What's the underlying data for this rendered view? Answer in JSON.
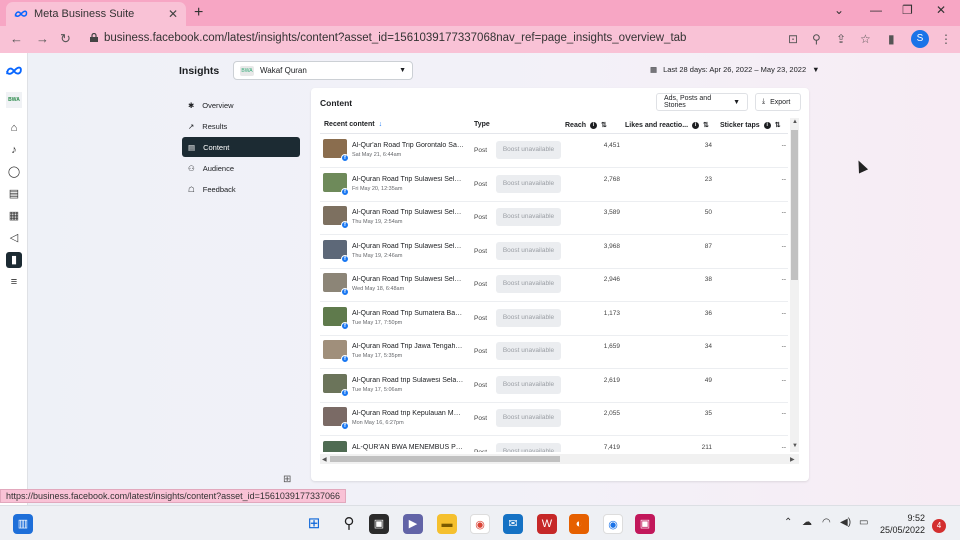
{
  "browser": {
    "tab_title": "Meta Business Suite",
    "tab_close": "✕",
    "new_tab": "+",
    "url": "business.facebook.com/latest/insights/content?asset_id=1561039177337068nav_ref=page_insights_overview_tab",
    "profile_initial": "S",
    "status_url": "https://business.facebook.com/latest/insights/content?asset_id=1561039177337066"
  },
  "rail": {
    "brand_label": "BWA"
  },
  "header": {
    "title": "Insights",
    "page_name": "Wakaf Quran",
    "page_avatar": "BWA",
    "date_range": "Last 28 days: Apr 26, 2022 – May 23, 2022"
  },
  "subnav": [
    {
      "label": "Overview",
      "icon": "sparkle-icon"
    },
    {
      "label": "Results",
      "icon": "chart-line-icon"
    },
    {
      "label": "Content",
      "icon": "content-icon"
    },
    {
      "label": "Audience",
      "icon": "people-icon"
    },
    {
      "label": "Feedback",
      "icon": "comment-icon"
    }
  ],
  "content": {
    "title": "Content",
    "filter_label": "Ads, Posts and Stories",
    "export_label": "Export",
    "columns": {
      "recent": "Recent content",
      "type": "Type",
      "reach": "Reach",
      "likes": "Likes and reactio...",
      "sticker": "Sticker taps"
    },
    "rows": [
      {
        "title": "Al-Qur'an Road Trip Gorontalo Sab...",
        "date": "Sat May 21, 6:44am",
        "type": "Post",
        "boost": "Boost unavailable",
        "reach": "4,451",
        "likes": "34",
        "sticker": "--",
        "thumb": "#8a6d4e"
      },
      {
        "title": "Al-Quran Road Trip Sulawesi Selata...",
        "date": "Fri May 20, 12:35am",
        "type": "Post",
        "boost": "Boost unavailable",
        "reach": "2,768",
        "likes": "23",
        "sticker": "--",
        "thumb": "#6e8a5a"
      },
      {
        "title": "Al-Quran Road Trip Sulawesi Selata...",
        "date": "Thu May 19, 2:54am",
        "type": "Post",
        "boost": "Boost unavailable",
        "reach": "3,589",
        "likes": "50",
        "sticker": "--",
        "thumb": "#7d7060"
      },
      {
        "title": "Al-Quran Road Trip Sulawesi Selata...",
        "date": "Thu May 19, 2:46am",
        "type": "Post",
        "boost": "Boost unavailable",
        "reach": "3,968",
        "likes": "87",
        "sticker": "--",
        "thumb": "#5d6878"
      },
      {
        "title": "Al-Quran Road Trip Sulawesi Selata...",
        "date": "Wed May 18, 6:48am",
        "type": "Post",
        "boost": "Boost unavailable",
        "reach": "2,946",
        "likes": "38",
        "sticker": "--",
        "thumb": "#8c8577"
      },
      {
        "title": "Al-Quran Road Trip Sumatera Barat...",
        "date": "Tue May 17, 7:50pm",
        "type": "Post",
        "boost": "Boost unavailable",
        "reach": "1,173",
        "likes": "36",
        "sticker": "--",
        "thumb": "#5f7a4c"
      },
      {
        "title": "Al-Quran Road Trip Jawa Tengah Di...",
        "date": "Tue May 17, 5:35pm",
        "type": "Post",
        "boost": "Boost unavailable",
        "reach": "1,659",
        "likes": "34",
        "sticker": "--",
        "thumb": "#a08f7b"
      },
      {
        "title": "Al-Quran Road trip Sulawesi Selata...",
        "date": "Tue May 17, 5:06am",
        "type": "Post",
        "boost": "Boost unavailable",
        "reach": "2,619",
        "likes": "49",
        "sticker": "--",
        "thumb": "#6b745a"
      },
      {
        "title": "Al-Quran Road trip Kepulauan Mal...",
        "date": "Mon May 16, 6:27pm",
        "type": "Post",
        "boost": "Boost unavailable",
        "reach": "2,055",
        "likes": "35",
        "sticker": "--",
        "thumb": "#7a6a65"
      },
      {
        "title": "AL-QUR'AN BWA MENEMBUS PED...",
        "date": "",
        "type": "Post",
        "boost": "Boost unavailable",
        "reach": "7,419",
        "likes": "211",
        "sticker": "--",
        "thumb": "#4f6b52"
      }
    ]
  },
  "taskbar": {
    "time": "9:52",
    "date": "25/05/2022",
    "notifications": "4"
  },
  "colors": {
    "chrome_pink": "#f7a6c4",
    "active_nav": "#1c2b33",
    "facebook_blue": "#1877f2"
  }
}
